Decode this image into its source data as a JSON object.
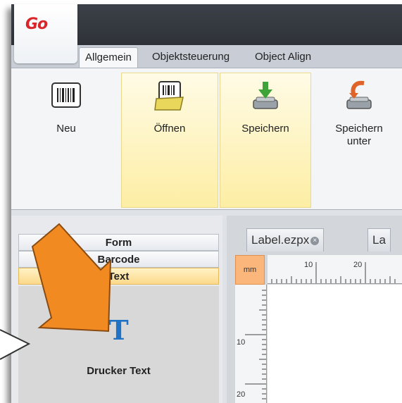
{
  "app": {
    "logo_text": "Go",
    "tabs": [
      {
        "label": "Allgemein",
        "active": true
      },
      {
        "label": "Objektsteuerung",
        "active": false
      },
      {
        "label": "Object Align",
        "active": false
      }
    ]
  },
  "ribbon": {
    "buttons": [
      {
        "label": "Neu",
        "icon": "barcode-document-icon"
      },
      {
        "label": "Öffnen",
        "icon": "barcode-folder-icon"
      },
      {
        "label": "Speichern",
        "icon": "save-drive-icon"
      },
      {
        "label": "Speichern unter",
        "icon": "save-as-drive-icon"
      }
    ]
  },
  "left_panel": {
    "sections": [
      "Form",
      "Barcode",
      "Text"
    ],
    "selected_section": "Text",
    "tool": {
      "icon": "text-T-icon",
      "label": "Drucker Text"
    }
  },
  "document": {
    "tabs": [
      {
        "label": "Label.ezpx"
      },
      {
        "label": "La"
      }
    ],
    "unit": "mm",
    "h_ruler_labels": [
      "10",
      "20"
    ],
    "v_ruler_labels": [
      "10",
      "20"
    ]
  },
  "annotation": {
    "arrow_color": "#f28a22"
  }
}
